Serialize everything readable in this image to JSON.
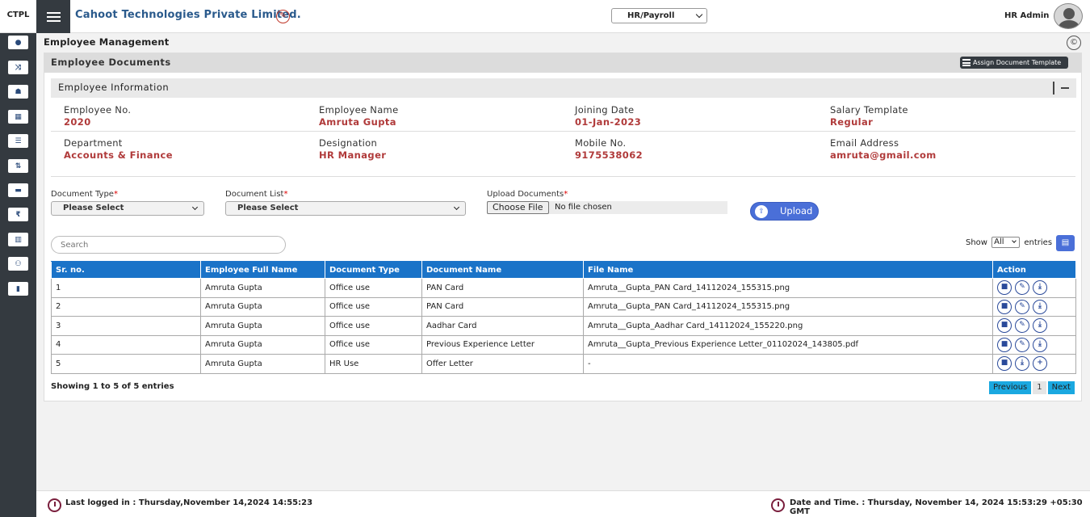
{
  "topbar": {
    "short_name": "CTPL",
    "company": "Cahoot Technologies Private Limited.",
    "module": "HR/Payroll",
    "user": "HR Admin"
  },
  "sidebar": {
    "icons": [
      "info-icon",
      "shuffle-icon",
      "users-icon",
      "calendar-icon",
      "list-icon",
      "sort-icon",
      "money-icon",
      "rupee-icon",
      "chart-icon",
      "org-chart-icon",
      "bookmark-icon"
    ]
  },
  "page": {
    "title": "Employee Management",
    "panel_title": "Employee Documents",
    "assign_label": "Assign Document Template"
  },
  "info": {
    "title": "Employee Information",
    "fields": [
      {
        "label": "Employee No.",
        "value": "2020"
      },
      {
        "label": "Employee Name",
        "value": "Amruta Gupta"
      },
      {
        "label": "Joining Date",
        "value": "01-Jan-2023"
      },
      {
        "label": "Salary Template",
        "value": "Regular"
      },
      {
        "label": "Department",
        "value": "Accounts & Finance"
      },
      {
        "label": "Designation",
        "value": "HR Manager"
      },
      {
        "label": "Mobile No.",
        "value": "9175538062"
      },
      {
        "label": "Email Address",
        "value": "amruta@gmail.com"
      }
    ]
  },
  "form": {
    "doc_type_label": "Document Type",
    "doc_type_value": "Please Select",
    "doc_list_label": "Document List",
    "doc_list_value": "Please Select",
    "upload_label": "Upload Documents",
    "choose_file": "Choose File",
    "no_file": "No file chosen",
    "upload_button": "Upload",
    "required_mark": "*"
  },
  "table_controls": {
    "search_placeholder": "Search",
    "show_label": "Show",
    "show_value": "All",
    "entries_label": "entries"
  },
  "table": {
    "headers": [
      "Sr. no.",
      "Employee Full Name",
      "Document Type",
      "Document Name",
      "File Name",
      "Action"
    ],
    "rows": [
      {
        "sr": "1",
        "name": "Amruta Gupta",
        "type": "Office use",
        "doc": "PAN Card",
        "file": "Amruta__Gupta_PAN Card_14112024_155315.png",
        "actions": [
          "delete-icon",
          "edit-icon",
          "download-icon"
        ]
      },
      {
        "sr": "2",
        "name": "Amruta Gupta",
        "type": "Office use",
        "doc": "PAN Card",
        "file": "Amruta__Gupta_PAN Card_14112024_155315.png",
        "actions": [
          "delete-icon",
          "edit-icon",
          "download-icon"
        ]
      },
      {
        "sr": "3",
        "name": "Amruta Gupta",
        "type": "Office use",
        "doc": "Aadhar Card",
        "file": "Amruta__Gupta_Aadhar Card_14112024_155220.png",
        "actions": [
          "delete-icon",
          "edit-icon",
          "download-icon"
        ]
      },
      {
        "sr": "4",
        "name": "Amruta Gupta",
        "type": "Office use",
        "doc": "Previous Experience Letter",
        "file": "Amruta__Gupta_Previous Experience Letter_01102024_143805.pdf",
        "actions": [
          "delete-icon",
          "edit-icon",
          "download-icon"
        ]
      },
      {
        "sr": "5",
        "name": "Amruta Gupta",
        "type": "HR Use",
        "doc": "Offer Letter",
        "file": "-",
        "actions": [
          "delete-icon",
          "download-icon",
          "add-icon"
        ]
      }
    ],
    "showing": "Showing 1 to 5 of 5 entries",
    "prev": "Previous",
    "page": "1",
    "next": "Next"
  },
  "footer": {
    "last_logged": "Last logged in : Thursday,November 14,2024 14:55:23",
    "datetime": "Date and Time. : Thursday, November 14, 2024 15:53:29 +05:30 GMT"
  }
}
